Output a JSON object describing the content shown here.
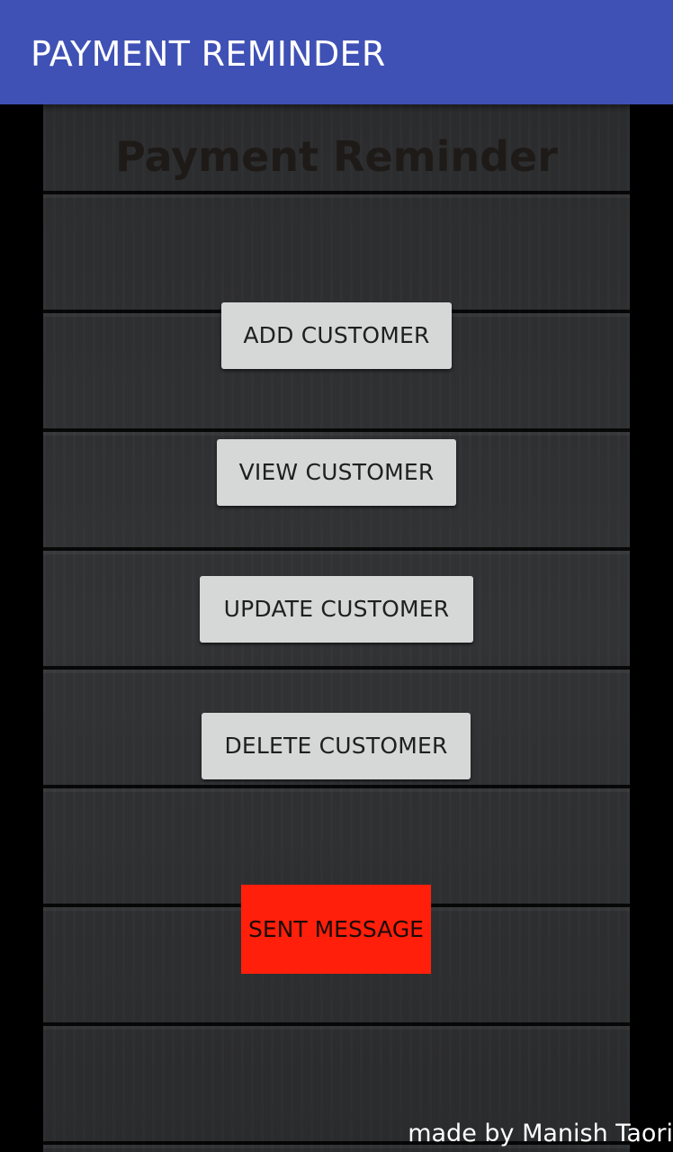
{
  "app_bar": {
    "title": "PAYMENT REMINDER",
    "color": "#3f51b5"
  },
  "main": {
    "heading": "Payment Reminder",
    "buttons": {
      "add": "ADD CUSTOMER",
      "view": "VIEW CUSTOMER",
      "update": "UPDATE CUSTOMER",
      "delete": "DELETE CUSTOMER"
    },
    "send_button": {
      "label": "SENT MESSAGE",
      "color": "#ff1f0a"
    },
    "footer": "made by Manish Taori"
  }
}
